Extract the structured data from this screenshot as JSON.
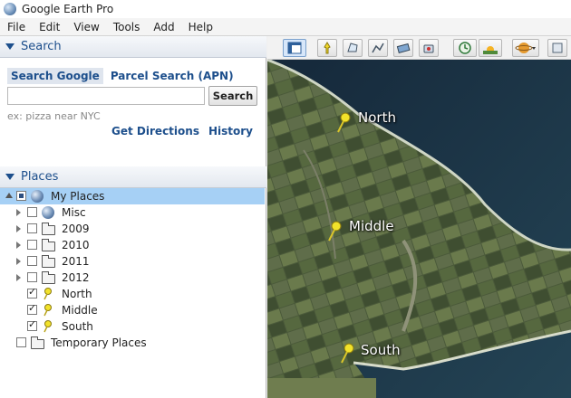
{
  "window": {
    "title": "Google Earth Pro"
  },
  "menu": [
    "File",
    "Edit",
    "View",
    "Tools",
    "Add",
    "Help"
  ],
  "search_panel": {
    "header": "Search",
    "tabs": [
      "Search Google",
      "Parcel Search (APN)"
    ],
    "input_value": "",
    "button": "Search",
    "hint": "ex: pizza near NYC",
    "links": [
      "Get Directions",
      "History"
    ]
  },
  "places_panel": {
    "header": "Places",
    "items": [
      {
        "label": "My Places",
        "icon": "globe-icon",
        "check": "partial",
        "expand": "open",
        "level": 0,
        "selected": true
      },
      {
        "label": "Misc",
        "icon": "globe-icon",
        "check": "none",
        "expand": "closed",
        "level": 1
      },
      {
        "label": "2009",
        "icon": "folder-icon",
        "check": "none",
        "expand": "closed",
        "level": 1
      },
      {
        "label": "2010",
        "icon": "folder-icon",
        "check": "none",
        "expand": "closed",
        "level": 1
      },
      {
        "label": "2011",
        "icon": "folder-icon",
        "check": "none",
        "expand": "closed",
        "level": 1
      },
      {
        "label": "2012",
        "icon": "folder-icon",
        "check": "none",
        "expand": "closed",
        "level": 1
      },
      {
        "label": "North",
        "icon": "pushpin-icon",
        "check": "checked",
        "expand": "none",
        "level": 1
      },
      {
        "label": "Middle",
        "icon": "pushpin-icon",
        "check": "checked",
        "expand": "none",
        "level": 1
      },
      {
        "label": "South",
        "icon": "pushpin-icon",
        "check": "checked",
        "expand": "none",
        "level": 1
      },
      {
        "label": "Temporary Places",
        "icon": "folder-icon",
        "check": "none",
        "expand": "none",
        "level": 0
      }
    ]
  },
  "toolbar": {
    "buttons": [
      "sidebar-toggle-icon",
      "add-placemark-icon",
      "add-polygon-icon",
      "add-path-icon",
      "add-image-overlay-icon",
      "record-tour-icon",
      "historical-imagery-icon",
      "sunlight-icon",
      "switch-planet-icon",
      "more-icon"
    ]
  },
  "map": {
    "placemarks": [
      "North",
      "Middle",
      "South"
    ],
    "colors": {
      "sea": "#1c3442",
      "land": "#4b5a3a",
      "pin": "#f2e22a"
    }
  }
}
